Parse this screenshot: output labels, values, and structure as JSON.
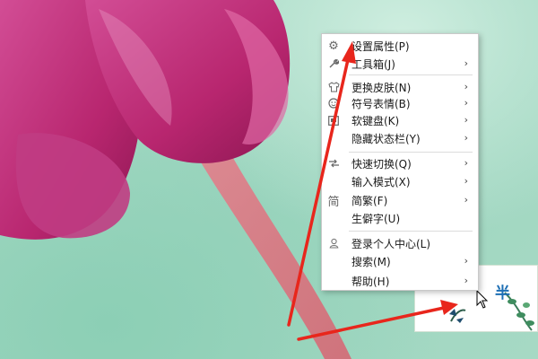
{
  "menu": {
    "items": [
      {
        "label": "设置属性(P)",
        "icon": "gear-icon",
        "submenu": false
      },
      {
        "label": "工具箱(J)",
        "icon": "wrench-icon",
        "submenu": true
      },
      {
        "label": "更换皮肤(N)",
        "icon": "shirt-icon",
        "submenu": true
      },
      {
        "label": "符号表情(B)",
        "icon": "smiley-icon",
        "submenu": true
      },
      {
        "label": "软键盘(K)",
        "icon": "keyboard-icon",
        "submenu": true
      },
      {
        "label": "隐藏状态栏(Y)",
        "icon": "",
        "submenu": true
      },
      {
        "label": "快速切换(Q)",
        "icon": "switch-icon",
        "submenu": true
      },
      {
        "label": "输入模式(X)",
        "icon": "",
        "submenu": true
      },
      {
        "label": "简繁(F)",
        "icon": "simplified-char-icon",
        "icon_text": "简",
        "submenu": true
      },
      {
        "label": "生僻字(U)",
        "icon": "",
        "submenu": false
      },
      {
        "label": "登录个人中心(L)",
        "icon": "user-icon",
        "submenu": false
      },
      {
        "label": "搜索(M)",
        "icon": "",
        "submenu": true
      },
      {
        "label": "帮助(H)",
        "icon": "",
        "submenu": true
      }
    ],
    "submenu_glyph": "›"
  },
  "statusbar": {
    "mode_char": "半"
  },
  "colors": {
    "arrow": "#e8261c",
    "flower": "#c8387e",
    "stem": "#e07f8a",
    "wallpaper": "#a6d9c4"
  }
}
